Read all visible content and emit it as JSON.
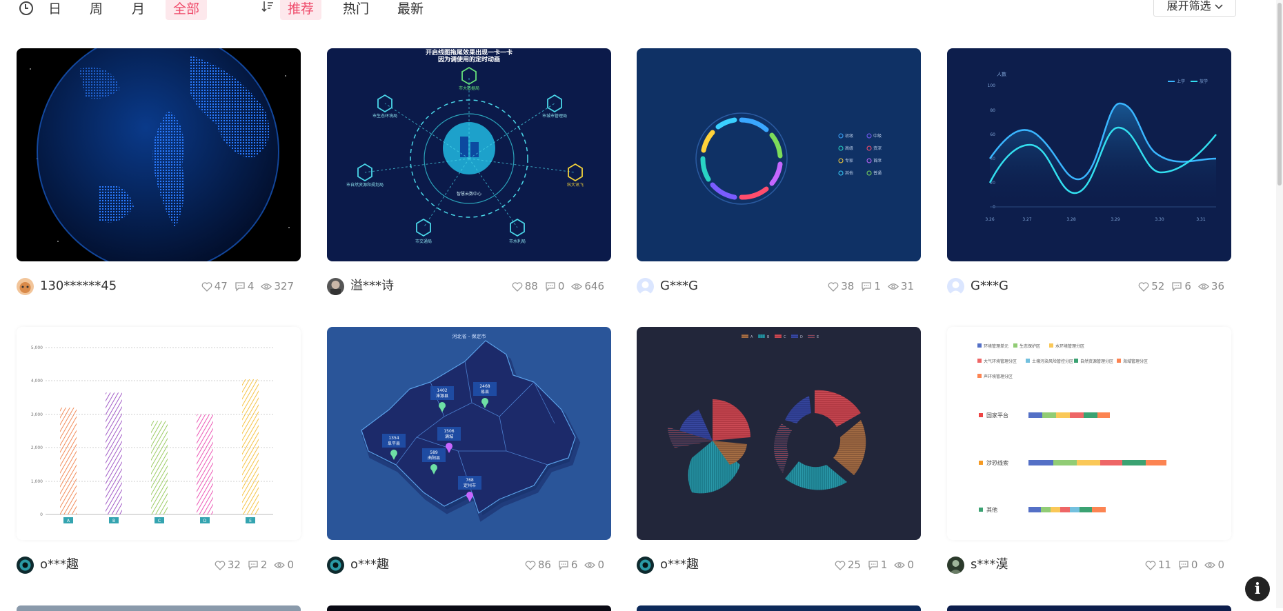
{
  "filter_bar": {
    "time_filters": [
      "日",
      "周",
      "月",
      "全部"
    ],
    "active_time": "全部",
    "sort_filters": [
      "推荐",
      "热门",
      "最新"
    ],
    "active_sort": "推荐",
    "expand_label": "展开筛选"
  },
  "charts": [
    {
      "title": "开启线图拖尾效果出现一卡一卡",
      "subtitle": "因为调使用的定时动画",
      "labels": [
        "市大数据局",
        "市生态环境局",
        "市城市管理局",
        "市自然资源和规划局",
        "科大讯飞",
        "市交通局",
        "市水利局",
        "智慧云数中心"
      ]
    },
    {
      "legend": [
        "初级",
        "中级",
        "高级",
        "资深",
        "专家",
        "首席",
        "其他",
        "普通"
      ]
    },
    {
      "ylabel": "人数",
      "legend": [
        "上学",
        "放学"
      ],
      "x": [
        "3.26",
        "3.27",
        "3.28",
        "3.29",
        "3.30",
        "3.31"
      ],
      "yticks": [
        "0",
        "20",
        "40",
        "60",
        "80",
        "100"
      ]
    },
    {
      "categories": [
        "A",
        "B",
        "C",
        "D",
        "E"
      ],
      "values": [
        3200,
        3650,
        2800,
        3000,
        4050
      ],
      "yticks": [
        "0",
        "1,000",
        "2,000",
        "3,000",
        "4,000",
        "5,000"
      ]
    },
    {
      "title": "河北省 - 保定市",
      "markers": [
        {
          "value": "1402",
          "name": "涞源县"
        },
        {
          "value": "2468",
          "name": "易县"
        },
        {
          "value": "1354",
          "name": "阜平县"
        },
        {
          "value": "1506",
          "name": "满城"
        },
        {
          "value": "589",
          "name": "曲阳县"
        },
        {
          "value": "768",
          "name": "定州市"
        }
      ]
    },
    {
      "legend": [
        "A",
        "B",
        "C",
        "D",
        "E"
      ]
    },
    {
      "legend": [
        "环境管理单元",
        "生态保护区",
        "水环境管理分区",
        "大气环境管理分区",
        "土壤污染风险管控分区",
        "自然资源管理分区",
        "海域管理分区",
        "声环境管理分区"
      ],
      "rows": [
        "国家平台",
        "涉恐线索",
        "其他"
      ]
    }
  ],
  "cards": [
    {
      "author": "130******45",
      "likes": "47",
      "comments": "4",
      "views": "327"
    },
    {
      "author": "溢***诗",
      "likes": "88",
      "comments": "0",
      "views": "646"
    },
    {
      "author": "G***G",
      "likes": "38",
      "comments": "1",
      "views": "31"
    },
    {
      "author": "G***G",
      "likes": "52",
      "comments": "6",
      "views": "36"
    },
    {
      "author": "o***趣",
      "likes": "32",
      "comments": "2",
      "views": "0"
    },
    {
      "author": "o***趣",
      "likes": "86",
      "comments": "6",
      "views": "0"
    },
    {
      "author": "o***趣",
      "likes": "25",
      "comments": "1",
      "views": "0"
    },
    {
      "author": "s***漠",
      "likes": "11",
      "comments": "0",
      "views": "0"
    }
  ],
  "colors": {
    "accent": "#ef4a6a",
    "accent_bg": "#fde8ec",
    "dark_navy": "#0d1e4c",
    "map_blue": "#2a5599"
  },
  "info_button": "i"
}
